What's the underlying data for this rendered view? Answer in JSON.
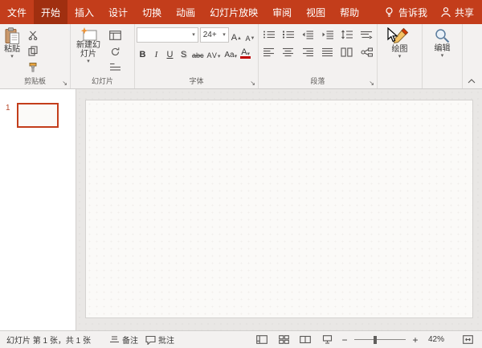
{
  "colors": {
    "brand": "#C33D1B",
    "tab_selected_bg": "#A02F10",
    "slide_border": "#C33D1B",
    "font_color_indicator": "#C00000"
  },
  "menubar": {
    "tabs": [
      {
        "label": "文件"
      },
      {
        "label": "开始",
        "selected": true
      },
      {
        "label": "插入"
      },
      {
        "label": "设计"
      },
      {
        "label": "切换"
      },
      {
        "label": "动画"
      },
      {
        "label": "幻灯片放映"
      },
      {
        "label": "审阅"
      },
      {
        "label": "视图"
      },
      {
        "label": "帮助"
      }
    ],
    "tell_me": "告诉我",
    "share": "共享"
  },
  "ribbon": {
    "clipboard": {
      "group_label": "剪贴板",
      "paste_label": "粘贴"
    },
    "slides": {
      "group_label": "幻灯片",
      "new_slide_label": "新建幻灯片"
    },
    "font": {
      "group_label": "字体",
      "font_name_value": "",
      "font_size_value": "24+",
      "grow_font": "A",
      "shrink_font": "A",
      "bold": "B",
      "italic": "I",
      "underline": "U",
      "shadow": "S",
      "strikethrough": "abc",
      "char_spacing": "AV",
      "change_case": "Aa",
      "font_color": "A"
    },
    "paragraph": {
      "group_label": "段落"
    },
    "drawing": {
      "label": "绘图"
    },
    "editing": {
      "label": "编辑"
    }
  },
  "slides_panel": {
    "slide_number": "1"
  },
  "statusbar": {
    "slide_info": "幻灯片 第 1 张，共 1 张",
    "notes": "备注",
    "comments": "批注",
    "zoom": "42%"
  }
}
